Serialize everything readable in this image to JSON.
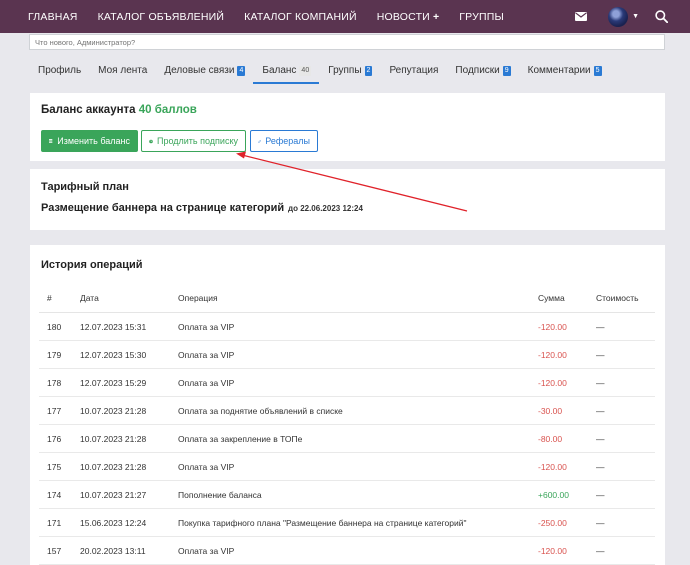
{
  "nav": {
    "items": [
      "ГЛАВНАЯ",
      "КАТАЛОГ ОБЪЯВЛЕНИЙ",
      "КАТАЛОГ КОМПАНИЙ",
      "НОВОСТИ",
      "ГРУППЫ"
    ],
    "news_plus": "+"
  },
  "status": {
    "placeholder": "Что нового, Администратор?"
  },
  "tabs": [
    {
      "label": "Профиль",
      "badge": ""
    },
    {
      "label": "Моя лента",
      "badge": ""
    },
    {
      "label": "Деловые связи",
      "badge": "4"
    },
    {
      "label": "Баланс",
      "badge": "40"
    },
    {
      "label": "Группы",
      "badge": "2"
    },
    {
      "label": "Репутация",
      "badge": ""
    },
    {
      "label": "Подписки",
      "badge": "9"
    },
    {
      "label": "Комментарии",
      "badge": "5"
    }
  ],
  "active_tab": "Баланс",
  "balance": {
    "title": "Баланс аккаунта",
    "amount": "40 баллов",
    "buttons": {
      "change": "Изменить баланс",
      "extend": "Продлить подписку",
      "referrals": "Рефералы"
    }
  },
  "plan": {
    "title": "Тарифный план",
    "name": "Размещение баннера на странице категорий",
    "until": "до 22.06.2023 12:24"
  },
  "history": {
    "title": "История операций",
    "columns": [
      "#",
      "Дата",
      "Операция",
      "Сумма",
      "Стоимость"
    ],
    "rows": [
      {
        "id": "180",
        "date": "12.07.2023 15:31",
        "op": "Оплата за VIP",
        "sum": "-120.00",
        "cost": "—"
      },
      {
        "id": "179",
        "date": "12.07.2023 15:30",
        "op": "Оплата за VIP",
        "sum": "-120.00",
        "cost": "—"
      },
      {
        "id": "178",
        "date": "12.07.2023 15:29",
        "op": "Оплата за VIP",
        "sum": "-120.00",
        "cost": "—"
      },
      {
        "id": "177",
        "date": "10.07.2023 21:28",
        "op": "Оплата за поднятие объявлений в списке",
        "sum": "-30.00",
        "cost": "—"
      },
      {
        "id": "176",
        "date": "10.07.2023 21:28",
        "op": "Оплата за закрепление в ТОПе",
        "sum": "-80.00",
        "cost": "—"
      },
      {
        "id": "175",
        "date": "10.07.2023 21:28",
        "op": "Оплата за VIP",
        "sum": "-120.00",
        "cost": "—"
      },
      {
        "id": "174",
        "date": "10.07.2023 21:27",
        "op": "Пополнение баланса",
        "sum": "+600.00",
        "cost": "—"
      },
      {
        "id": "171",
        "date": "15.06.2023 12:24",
        "op": "Покупка тарифного плана \"Размещение баннера на странице категорий\"",
        "sum": "-250.00",
        "cost": "—"
      },
      {
        "id": "157",
        "date": "20.02.2023 13:11",
        "op": "Оплата за VIP",
        "sum": "-120.00",
        "cost": "—"
      }
    ]
  },
  "colors": {
    "topbar": "#5a3450",
    "green": "#3aa55a",
    "blue": "#2a7ad4",
    "red": "#d9534f",
    "arrow": "#e0222a"
  },
  "icons": [
    "envelope-icon",
    "avatar",
    "chevron-down-icon",
    "search-icon",
    "wallet-icon",
    "clock-icon",
    "link-icon"
  ]
}
